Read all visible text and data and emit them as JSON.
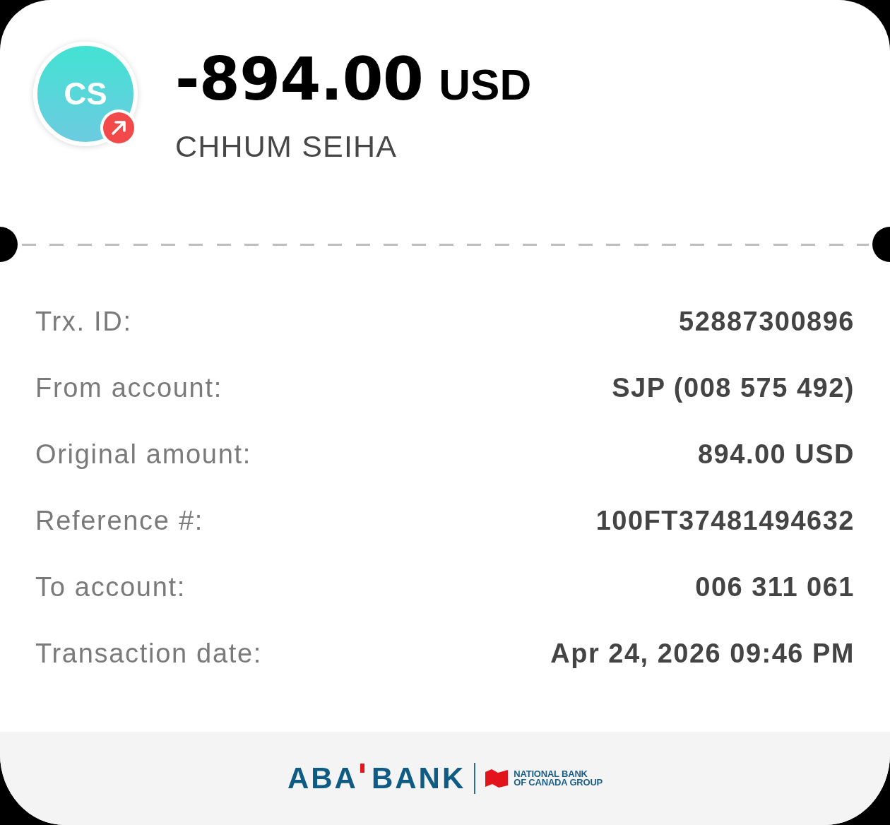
{
  "avatar": {
    "initials": "CS",
    "badge": {
      "kind": "outgoing"
    }
  },
  "amount": "-894.00",
  "currency": "USD",
  "counterparty": "CHHUM SEIHA",
  "details": [
    {
      "label": "Trx. ID:",
      "value": "52887300896"
    },
    {
      "label": "From account:",
      "value": "SJP (008 575 492)"
    },
    {
      "label": "Original amount:",
      "value": "894.00 USD"
    },
    {
      "label": "Reference #:",
      "value": "100FT37481494632"
    },
    {
      "label": "To account:",
      "value": "006 311 061"
    },
    {
      "label": "Transaction date:",
      "value": "Apr 24, 2026 09:46 PM"
    }
  ],
  "footer": {
    "brand": [
      "ABA",
      "BANK"
    ],
    "group": [
      "NATIONAL BANK",
      "OF CANADA GROUP"
    ]
  }
}
